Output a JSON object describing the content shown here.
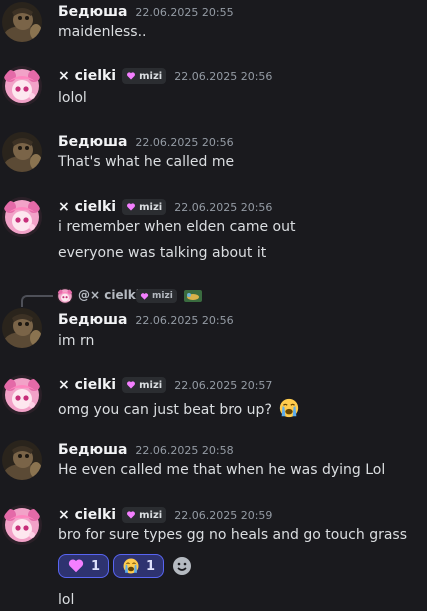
{
  "messages": [
    {
      "author": "Бедюша",
      "timestamp": "22.06.2025 20:55",
      "lines": [
        "maidenless.."
      ]
    },
    {
      "author": "× cielki",
      "tag": "mizi",
      "timestamp": "22.06.2025 20:56",
      "lines": [
        "lolol"
      ]
    },
    {
      "author": "Бедюша",
      "timestamp": "22.06.2025 20:56",
      "lines": [
        "That's what he called me"
      ]
    },
    {
      "author": "× cielki",
      "tag": "mizi",
      "timestamp": "22.06.2025 20:56",
      "lines": [
        "i remember when elden came out",
        "everyone was talking about it"
      ]
    },
    {
      "reply_to": {
        "author": "@× cielki",
        "tag": "mizi"
      },
      "author": "Бедюша",
      "timestamp": "22.06.2025 20:56",
      "lines": [
        "im rn"
      ]
    },
    {
      "author": "× cielki",
      "tag": "mizi",
      "timestamp": "22.06.2025 20:57",
      "lines": [
        "omg you can just beat bro up?"
      ],
      "trailing_emoji": "loudly-crying-face"
    },
    {
      "author": "Бедюша",
      "timestamp": "22.06.2025 20:58",
      "lines": [
        "He even called me that when he was dying Lol"
      ]
    },
    {
      "author": "× cielki",
      "tag": "mizi",
      "timestamp": "22.06.2025 20:59",
      "lines": [
        "bro for sure types gg no heals and go touch grass",
        "lol"
      ],
      "reactions": [
        {
          "emoji": "pink-heart",
          "count": "1"
        },
        {
          "emoji": "loudly-crying-face",
          "count": "1"
        }
      ]
    }
  ],
  "colors": {
    "background": "#1a1a1e",
    "username": "#f2f3f5",
    "text": "#dbdee1",
    "timestamp": "#949ba4",
    "reaction_bg": "#2e3370",
    "reaction_border": "#5865f2",
    "tag_heart": "#f47fff"
  }
}
